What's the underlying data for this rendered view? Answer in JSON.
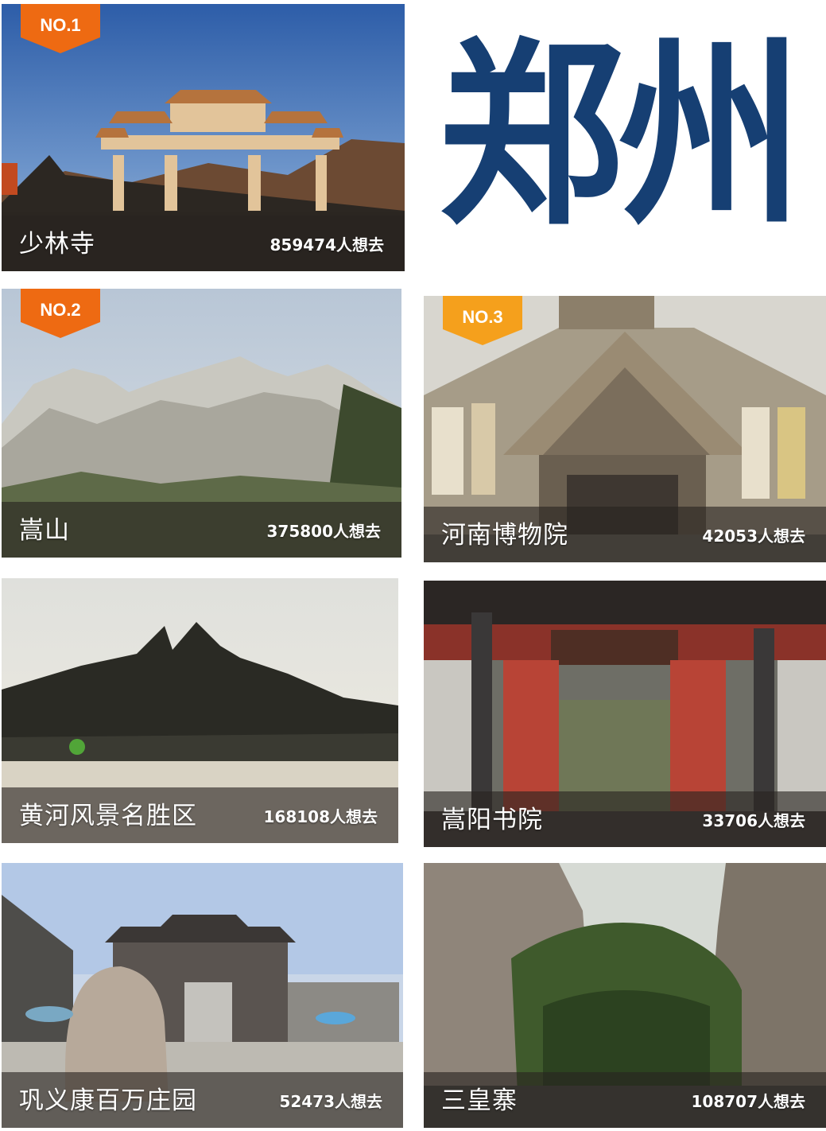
{
  "city": "郑州",
  "attractions": [
    {
      "rank": "NO.1",
      "name": "少林寺",
      "count": "859474人想去"
    },
    {
      "rank": "NO.2",
      "name": "嵩山",
      "count": "375800人想去"
    },
    {
      "rank": "NO.3",
      "name": "河南博物院",
      "count": "42053人想去"
    },
    {
      "rank": "",
      "name": "黄河风景名胜区",
      "count": "168108人想去"
    },
    {
      "rank": "",
      "name": "嵩阳书院",
      "count": "33706人想去"
    },
    {
      "rank": "",
      "name": "巩义康百万庄园",
      "count": "52473人想去"
    },
    {
      "rank": "",
      "name": "三皇寨",
      "count": "108707人想去"
    }
  ],
  "colors": {
    "title": "#163f73",
    "badge_primary": "#ee6a12",
    "badge_third": "#f5a01c"
  }
}
